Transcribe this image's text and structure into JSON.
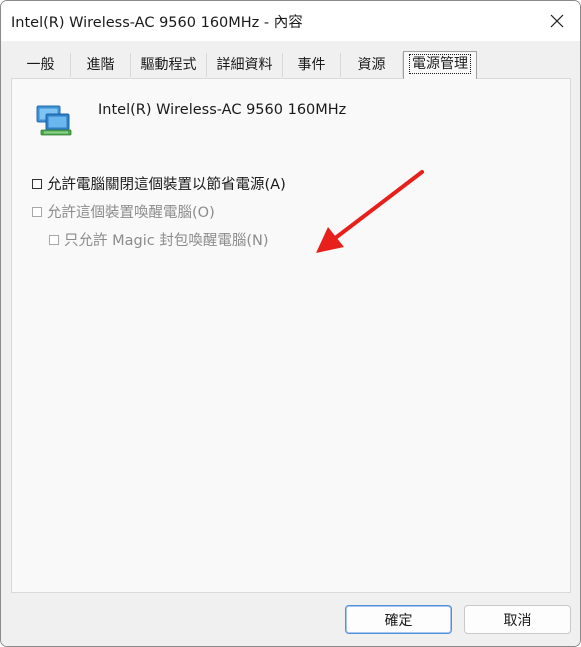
{
  "window": {
    "title": "Intel(R) Wireless-AC 9560 160MHz - 內容"
  },
  "tabs": [
    {
      "label": "一般"
    },
    {
      "label": "進階"
    },
    {
      "label": "驅動程式"
    },
    {
      "label": "詳細資料"
    },
    {
      "label": "事件"
    },
    {
      "label": "資源"
    },
    {
      "label": "電源管理",
      "active": true
    }
  ],
  "device": {
    "name": "Intel(R) Wireless-AC 9560 160MHz",
    "icon": "network-adapter-icon"
  },
  "options": [
    {
      "label": "允許電腦關閉這個裝置以節省電源(A)",
      "checked": false,
      "enabled": true
    },
    {
      "label": "允許這個裝置喚醒電腦(O)",
      "checked": false,
      "enabled": false
    },
    {
      "label": "只允許 Magic 封包喚醒電腦(N)",
      "checked": false,
      "enabled": false
    }
  ],
  "annotation": {
    "arrow_color": "#e8201c"
  },
  "buttons": {
    "ok": "確定",
    "cancel": "取消"
  },
  "colors": {
    "accent": "#4f8fdc",
    "disabled_text": "#8c8c8c"
  }
}
